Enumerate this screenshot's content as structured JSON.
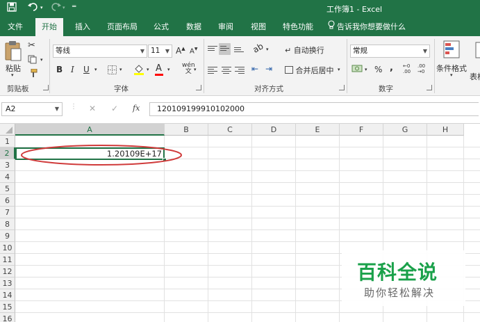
{
  "window": {
    "title": "工作簿1 - Excel",
    "quick_access": {
      "save_icon": "save-icon",
      "undo_icon": "undo-icon",
      "redo_icon": "redo-icon",
      "customize_icon": "customize-qat-icon"
    }
  },
  "ribbon_tabs": [
    "文件",
    "开始",
    "插入",
    "页面布局",
    "公式",
    "数据",
    "审阅",
    "视图",
    "特色功能"
  ],
  "active_tab": "开始",
  "tell_me": "告诉我你想要做什么",
  "ribbon": {
    "clipboard": {
      "paste_label": "粘贴",
      "group_label": "剪贴板"
    },
    "font": {
      "font_name": "等线",
      "font_size": "11",
      "grow": "A",
      "shrink": "A",
      "bold": "B",
      "italic": "I",
      "underline": "U",
      "font_color_letter": "A",
      "fill_color": "#ffff00",
      "font_color": "#ff0000",
      "group_label": "字体"
    },
    "alignment": {
      "wrap_label": "自动换行",
      "merge_label": "合并后居中",
      "group_label": "对齐方式"
    },
    "number": {
      "format": "常规",
      "percent": "%",
      "comma": ",",
      "group_label": "数字"
    },
    "styles": {
      "cond_format_label": "条件格式",
      "table_label": "表格"
    }
  },
  "formula_bar": {
    "name_box": "A2",
    "formula": "120109199910102000",
    "cancel": "✕",
    "enter": "✓",
    "fx": "fx"
  },
  "sheet": {
    "columns": [
      "A",
      "B",
      "C",
      "D",
      "E",
      "F",
      "G",
      "H"
    ],
    "rows": [
      "1",
      "2",
      "3",
      "4",
      "5",
      "6",
      "7",
      "8",
      "9",
      "10",
      "11",
      "12",
      "13",
      "14",
      "15",
      "16"
    ],
    "selected_cell": "A2",
    "cell_a2_value": "1.20109E+17",
    "highlight_color": "#d03b3b"
  },
  "watermark": {
    "title": "百科全说",
    "subtitle": "助你轻松解决"
  },
  "colors": {
    "excel_green": "#217346"
  }
}
